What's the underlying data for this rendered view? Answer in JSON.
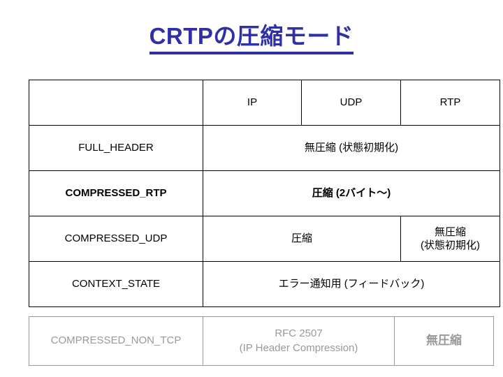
{
  "slide": {
    "title": "CRTPの圧縮モード",
    "title_color": "#2f2fa8"
  },
  "table": {
    "columns": [
      "",
      "IP",
      "UDP",
      "RTP"
    ],
    "header": {
      "blank_label": "",
      "ip": "IP",
      "udp": "UDP",
      "rtp": "RTP"
    },
    "rows": [
      {
        "label": "FULL_HEADER",
        "label_style": "normal",
        "value_span3": "無圧縮 (状態初期化)",
        "value_style": "normal"
      },
      {
        "label": "COMPRESSED_RTP",
        "label_style": "red-bold",
        "value_span3": "圧縮 (2バイト〜)",
        "value_style": "bold"
      },
      {
        "label": "COMPRESSED_UDP",
        "label_style": "normal",
        "value_span2": "圧縮",
        "value_rtp_line1": "無圧縮",
        "value_rtp_line2": "(状態初期化)"
      },
      {
        "label": "CONTEXT_STATE",
        "label_style": "normal",
        "value_span3": "エラー通知用 (フィードバック)",
        "value_style": "normal"
      }
    ],
    "detached_row": {
      "label": "COMPRESSED_NON_TCP",
      "value_line1": "RFC 2507",
      "value_line2": "(IP Header Compression)",
      "value_rtp": "無圧縮",
      "text_color": "#999999"
    }
  }
}
